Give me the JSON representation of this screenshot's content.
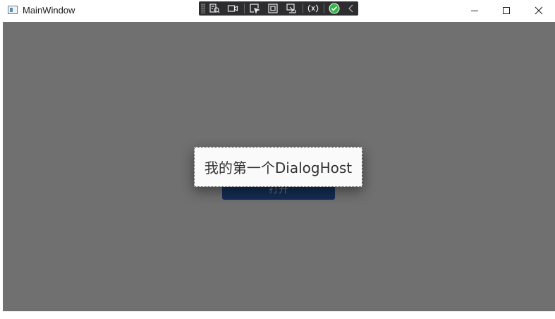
{
  "window": {
    "title": "MainWindow",
    "icon": "window-app-icon",
    "controls": [
      "minimize-icon",
      "maximize-icon",
      "close-icon"
    ]
  },
  "debug_toolbar": {
    "icons": [
      "grip-handle",
      "live-visual-tree-icon",
      "video-camera-icon",
      "select-element-icon",
      "display-layout-adorners-icon",
      "track-focus-icon",
      "hot-reload-icon",
      "binding-check-icon",
      "collapse-chevron-icon"
    ]
  },
  "main": {
    "open_button_label": "打开"
  },
  "dialog": {
    "text": "我的第一个DialogHost"
  },
  "colors": {
    "overlay": "#707070",
    "button": "#2f68bf",
    "dialog_background": "#fafafa",
    "debug_toolbar": "#2d2d30",
    "check_green": "#38b24a"
  }
}
